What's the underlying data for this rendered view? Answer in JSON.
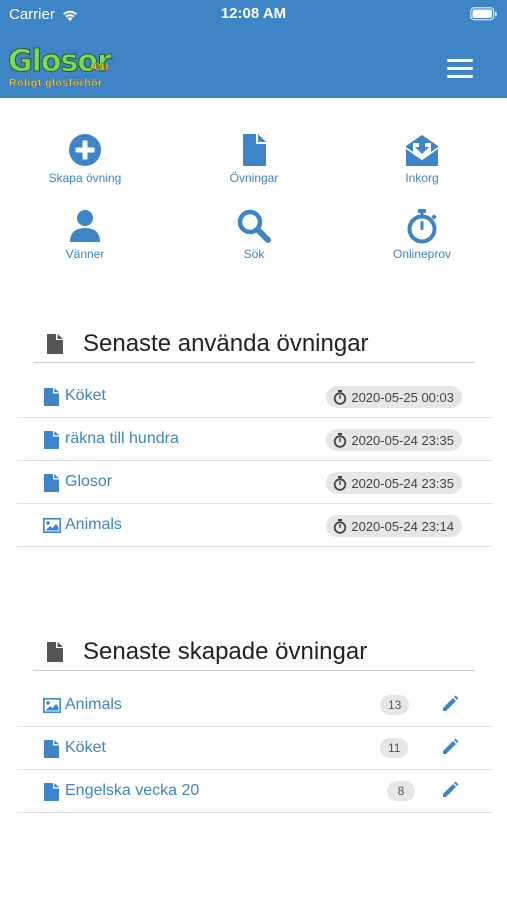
{
  "status_bar": {
    "carrier": "Carrier",
    "time": "12:08 AM"
  },
  "header": {
    "logo_name": "Glosor",
    "logo_domain": ".eu",
    "logo_slogan": "Roligt glosförhör"
  },
  "nav_grid": [
    {
      "label": "Skapa övning",
      "icon": "plus-circle-icon"
    },
    {
      "label": "Övningar",
      "icon": "document-icon"
    },
    {
      "label": "Inkorg",
      "icon": "inbox-envelope-icon"
    },
    {
      "label": "Vänner",
      "icon": "user-icon"
    },
    {
      "label": "Sök",
      "icon": "search-icon"
    },
    {
      "label": "Onlineprov",
      "icon": "stopwatch-icon"
    }
  ],
  "recent_used": {
    "title": "Senaste använda övningar",
    "items": [
      {
        "title": "Köket",
        "timestamp": "2020-05-25 00:03",
        "icon": "document-icon"
      },
      {
        "title": "räkna till hundra",
        "timestamp": "2020-05-24 23:35",
        "icon": "document-icon"
      },
      {
        "title": "Glosor",
        "timestamp": "2020-05-24 23:35",
        "icon": "document-icon"
      },
      {
        "title": "Animals",
        "timestamp": "2020-05-24 23:14",
        "icon": "image-icon"
      }
    ]
  },
  "recent_created": {
    "title": "Senaste skapade övningar",
    "items": [
      {
        "title": "Animals",
        "count": "13",
        "icon": "image-icon"
      },
      {
        "title": "Köket",
        "count": "11",
        "icon": "document-icon"
      },
      {
        "title": "Engelska vecka 20",
        "count": "8",
        "icon": "document-icon"
      }
    ]
  },
  "colors": {
    "header_bg": "#3d85c6",
    "accent": "#3d85c6",
    "badge_bg": "#e6e6e6"
  }
}
